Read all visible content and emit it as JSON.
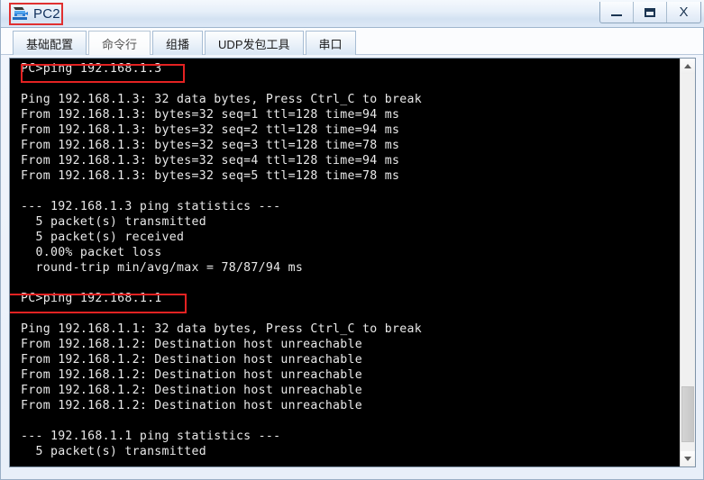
{
  "window": {
    "title": "PC2",
    "icon": "pc-device-icon",
    "controls": {
      "minimize": "–",
      "maximize": "□",
      "close": "X"
    },
    "accent_red": "#e42222",
    "title_color": "#10305c"
  },
  "tabs": [
    {
      "label": "基础配置",
      "active": false
    },
    {
      "label": "命令行",
      "active": true
    },
    {
      "label": "组播",
      "active": false
    },
    {
      "label": "UDP发包工具",
      "active": false
    },
    {
      "label": "串口",
      "active": false
    }
  ],
  "console": {
    "background": "#000000",
    "foreground": "#e9e9e9",
    "lines": [
      "PC>ping 192.168.1.3",
      "",
      "Ping 192.168.1.3: 32 data bytes, Press Ctrl_C to break",
      "From 192.168.1.3: bytes=32 seq=1 ttl=128 time=94 ms",
      "From 192.168.1.3: bytes=32 seq=2 ttl=128 time=94 ms",
      "From 192.168.1.3: bytes=32 seq=3 ttl=128 time=78 ms",
      "From 192.168.1.3: bytes=32 seq=4 ttl=128 time=94 ms",
      "From 192.168.1.3: bytes=32 seq=5 ttl=128 time=78 ms",
      "",
      "--- 192.168.1.3 ping statistics ---",
      "  5 packet(s) transmitted",
      "  5 packet(s) received",
      "  0.00% packet loss",
      "  round-trip min/avg/max = 78/87/94 ms",
      "",
      "PC>ping 192.168.1.1",
      "",
      "Ping 192.168.1.1: 32 data bytes, Press Ctrl_C to break",
      "From 192.168.1.2: Destination host unreachable",
      "From 192.168.1.2: Destination host unreachable",
      "From 192.168.1.2: Destination host unreachable",
      "From 192.168.1.2: Destination host unreachable",
      "From 192.168.1.2: Destination host unreachable",
      "",
      "--- 192.168.1.1 ping statistics ---",
      "  5 packet(s) transmitted"
    ],
    "highlights": [
      {
        "name": "ping-command-1-highlight",
        "text": "PC>ping 192.168.1.3"
      },
      {
        "name": "ping-command-2-highlight",
        "text": "PC>ping 192.168.1.1"
      }
    ]
  },
  "scrollbar": {
    "up_arrow": "scroll-up-icon",
    "down_arrow": "scroll-down-icon",
    "thumb": "scroll-thumb"
  }
}
